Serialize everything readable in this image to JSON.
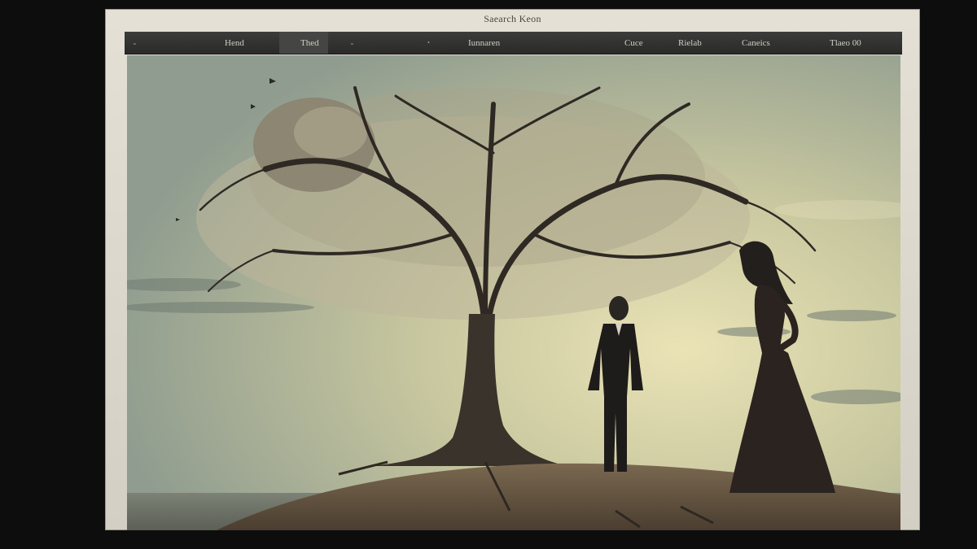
{
  "window": {
    "title": "Saearch Keon"
  },
  "menubar": {
    "items": [
      {
        "label": "⌄",
        "name": "menu-dropdown-toggle"
      },
      {
        "label": "Hend",
        "name": "menu-hend"
      },
      {
        "label": "Thed",
        "name": "menu-thed"
      },
      {
        "label": "⌄",
        "name": "menu-thed-chevron"
      },
      {
        "label": "•",
        "name": "menu-dot"
      },
      {
        "label": "Iunnaren",
        "name": "menu-iunnaren"
      },
      {
        "label": "Cuce",
        "name": "menu-cuce"
      },
      {
        "label": "Rielab",
        "name": "menu-rielab"
      },
      {
        "label": "Caneics",
        "name": "menu-caneics"
      },
      {
        "label": "Tlaeo 00",
        "name": "menu-tlaeo"
      }
    ]
  },
  "canvas": {
    "scene": "sepia tree on a hill with a man in a suit and a woman in a long dress",
    "colors": {
      "sky_top": "#98a597",
      "sky_glow": "#eae3b6",
      "ground": "#6b5a45"
    }
  }
}
